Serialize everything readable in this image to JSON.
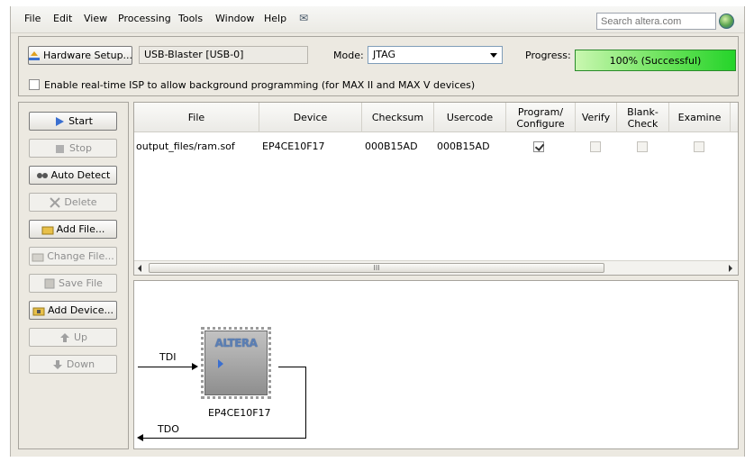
{
  "menu": [
    "File",
    "Edit",
    "View",
    "Processing",
    "Tools",
    "Window",
    "Help"
  ],
  "search": {
    "placeholder": "Search altera.com"
  },
  "toolbar": {
    "hardware_setup": "Hardware Setup...",
    "hardware_value": "USB-Blaster [USB-0]",
    "mode_label": "Mode:",
    "mode_value": "JTAG",
    "progress_label": "Progress:",
    "progress_text": "100% (Successful)",
    "progress_value": 100,
    "isp_label": "Enable real-time ISP to allow background programming (for MAX II and MAX V devices)",
    "isp_checked": false
  },
  "side_buttons": [
    {
      "label": "Start",
      "enabled": true
    },
    {
      "label": "Stop",
      "enabled": false
    },
    {
      "label": "Auto Detect",
      "enabled": true
    },
    {
      "label": "Delete",
      "enabled": false
    },
    {
      "label": "Add File...",
      "enabled": true
    },
    {
      "label": "Change File...",
      "enabled": false
    },
    {
      "label": "Save File",
      "enabled": false
    },
    {
      "label": "Add Device...",
      "enabled": true
    },
    {
      "label": "Up",
      "enabled": false
    },
    {
      "label": "Down",
      "enabled": false
    }
  ],
  "table": {
    "columns": [
      "File",
      "Device",
      "Checksum",
      "Usercode",
      "Program/\nConfigure",
      "Verify",
      "Blank-\nCheck",
      "Examine"
    ],
    "rows": [
      {
        "file": "output_files/ram.sof",
        "device": "EP4CE10F17",
        "checksum": "000B15AD",
        "usercode": "000B15AD",
        "program": true,
        "verify": false,
        "blank_check": false,
        "examine": false
      }
    ],
    "scroll_grip": "III"
  },
  "diagram": {
    "tdi": "TDI",
    "tdo": "TDO",
    "chip_logo": "ALTERA",
    "chip_name": "EP4CE10F17"
  },
  "colors": {
    "progress_green": "#25d42a",
    "link_blue": "#3a6fd0"
  }
}
